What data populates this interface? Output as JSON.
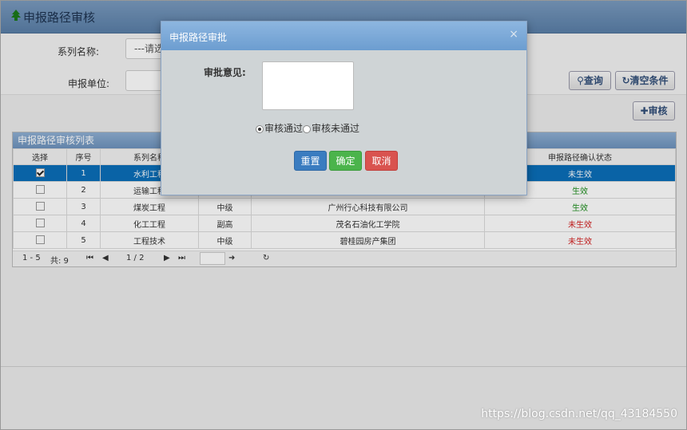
{
  "header": {
    "title": "申报路径审核"
  },
  "search": {
    "series_label": "系列名称:",
    "series_value": "---请选",
    "unit_label": "申报单位:",
    "unit_value": "",
    "query_label": "查询",
    "clear_label": "清空条件",
    "audit_label": "审核"
  },
  "table": {
    "title": "申报路径审核列表",
    "columns": [
      "选择",
      "序号",
      "系列名称",
      "",
      "",
      "申报路径确认状态"
    ],
    "rows": [
      {
        "index": "1",
        "series": "水利工程",
        "level": "",
        "unit": "",
        "status": "未生效",
        "checked": true,
        "selected": true
      },
      {
        "index": "2",
        "series": "运输工程",
        "level": "",
        "unit": "",
        "status": "生效",
        "checked": false,
        "selected": false
      },
      {
        "index": "3",
        "series": "煤炭工程",
        "level": "中级",
        "unit": "广州行心科技有限公司",
        "status": "生效",
        "checked": false,
        "selected": false
      },
      {
        "index": "4",
        "series": "化工工程",
        "level": "副高",
        "unit": "茂名石油化工学院",
        "status": "未生效",
        "checked": false,
        "selected": false
      },
      {
        "index": "5",
        "series": "工程技术",
        "level": "中级",
        "unit": "碧桂园房产集团",
        "status": "未生效",
        "checked": false,
        "selected": false
      }
    ],
    "pager": {
      "range": "1 - 5",
      "total": "共: 9",
      "page": "1 / 2"
    }
  },
  "modal": {
    "title": "申报路径审批",
    "close": "×",
    "opinion_label": "审批意见:",
    "opinion_value": "",
    "radio_pass": "审核通过",
    "radio_fail": "审核未通过",
    "reset": "重置",
    "confirm": "确定",
    "cancel": "取消"
  },
  "colors": {
    "reset": "#3a7cc0",
    "confirm": "#4bb44b",
    "cancel": "#d9534f",
    "selected_row": "#0b6fb9"
  },
  "watermark": "https://blog.csdn.net/qq_43184550"
}
